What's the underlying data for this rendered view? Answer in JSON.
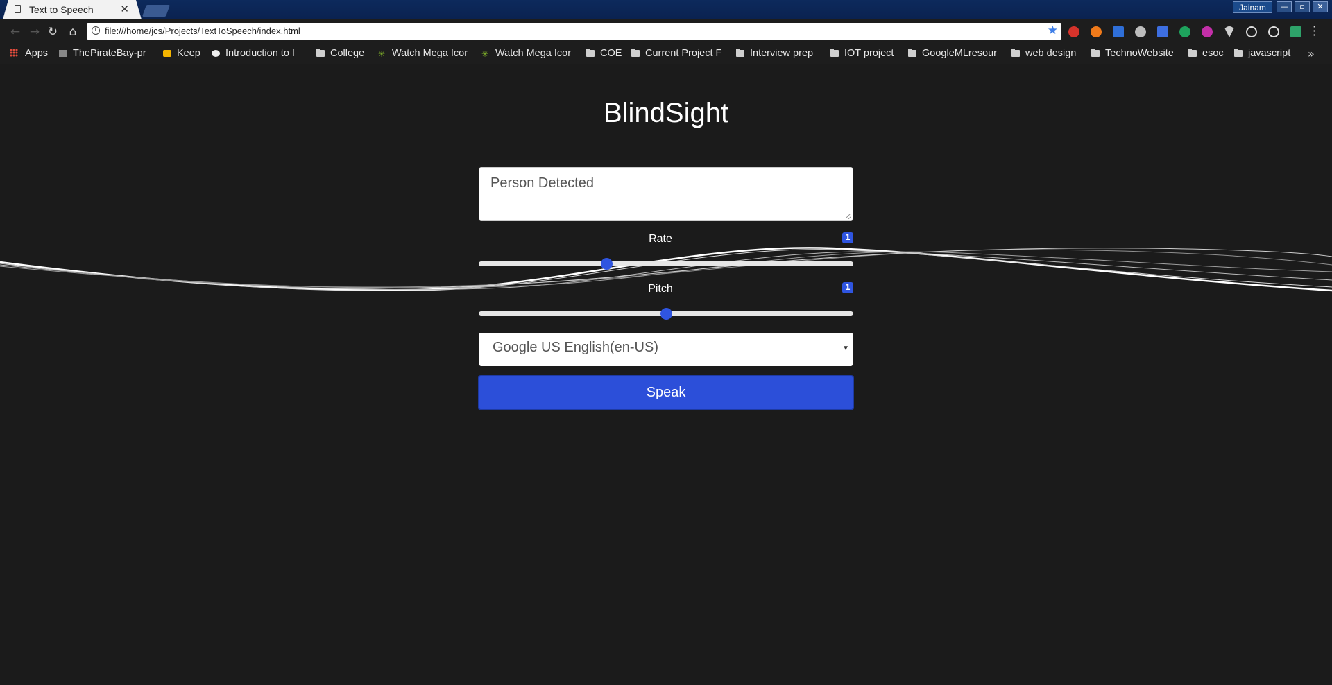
{
  "browser": {
    "tab_title": "Text to Speech",
    "tab_close": "✕",
    "profile_name": "Jainam",
    "url": "file:///home/jcs/Projects/TextToSpeech/index.html"
  },
  "bookmarks": [
    {
      "label": "Apps",
      "icon": "apps-grid-icon"
    },
    {
      "label": "ThePirateBay-pr",
      "icon": "pirate-icon"
    },
    {
      "label": "Keep",
      "icon": "keep-icon"
    },
    {
      "label": "Introduction to I",
      "icon": "globe-icon"
    },
    {
      "label": "College",
      "icon": "folder-icon"
    },
    {
      "label": "Watch Mega Icor",
      "icon": "leaf-icon"
    },
    {
      "label": "Watch Mega Icor",
      "icon": "leaf-icon"
    },
    {
      "label": "COE",
      "icon": "folder-icon"
    },
    {
      "label": "Current Project F",
      "icon": "folder-icon"
    },
    {
      "label": "Interview prep",
      "icon": "folder-icon"
    },
    {
      "label": "IOT project",
      "icon": "folder-icon"
    },
    {
      "label": "GoogleMLresour",
      "icon": "folder-icon"
    },
    {
      "label": "web design",
      "icon": "folder-icon"
    },
    {
      "label": "TechnoWebsite",
      "icon": "folder-icon"
    },
    {
      "label": "esoc",
      "icon": "folder-icon"
    },
    {
      "label": "javascript",
      "icon": "folder-icon"
    }
  ],
  "bookmarks_more": "»",
  "app": {
    "title": "BlindSight",
    "text_value": "Person Detected",
    "rate": {
      "label": "Rate",
      "value": "1",
      "level": 0.34
    },
    "pitch": {
      "label": "Pitch",
      "value": "1",
      "level": 0.5
    },
    "voice_selected": "Google US English(en-US)",
    "speak_label": "Speak"
  },
  "colors": {
    "accent": "#2c4fd9",
    "page_background": "#1b1b1b",
    "tab_strip": "#0d2a5c"
  }
}
